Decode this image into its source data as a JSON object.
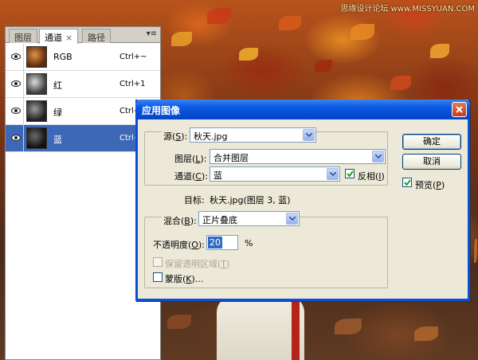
{
  "watermark": "思缘设计论坛 www.MISSYUAN.COM",
  "panel": {
    "tabs": [
      {
        "label": "图层"
      },
      {
        "label": "通道",
        "close": "×"
      },
      {
        "label": "路径"
      }
    ],
    "menu_glyph": "▾≡",
    "channels": [
      {
        "name": "RGB",
        "shortcut": "Ctrl+~"
      },
      {
        "name": "红",
        "shortcut": "Ctrl+1"
      },
      {
        "name": "绿",
        "shortcut": "Ctrl+"
      },
      {
        "name": "蓝",
        "shortcut": "Ctrl+"
      }
    ]
  },
  "dialog": {
    "title": "应用图像",
    "source": {
      "label": "源(",
      "key": "S",
      "end": "):",
      "value": "秋天.jpg"
    },
    "layer": {
      "label": "图层(",
      "key": "L",
      "end": "):",
      "value": "合并图层"
    },
    "channel": {
      "label": "通道(",
      "key": "C",
      "end": "):",
      "value": "蓝"
    },
    "invert": {
      "label": "反相(",
      "key": "I",
      "end": ")",
      "checked": true
    },
    "target": {
      "label": "目标:",
      "value": "秋天.jpg(图层 3, 蓝)"
    },
    "blending": {
      "label": "混合(",
      "key": "B",
      "end": "):",
      "value": "正片叠底"
    },
    "opacity": {
      "label": "不透明度(",
      "key": "O",
      "end": "):",
      "value": "20",
      "unit": "%"
    },
    "preserve": {
      "label": "保留透明区域(",
      "key": "T",
      "end": ")",
      "checked": false,
      "enabled": false
    },
    "mask": {
      "label": "蒙版(",
      "key": "K",
      "end": ")...",
      "checked": false
    },
    "ok": "确定",
    "cancel": "取消",
    "preview": {
      "label": "预览(",
      "key": "P",
      "end": ")",
      "checked": true
    }
  },
  "colors": {
    "accent": "#3d68b8",
    "titlebar": "#0958e0",
    "dialog_bg": "#ece9d8"
  }
}
